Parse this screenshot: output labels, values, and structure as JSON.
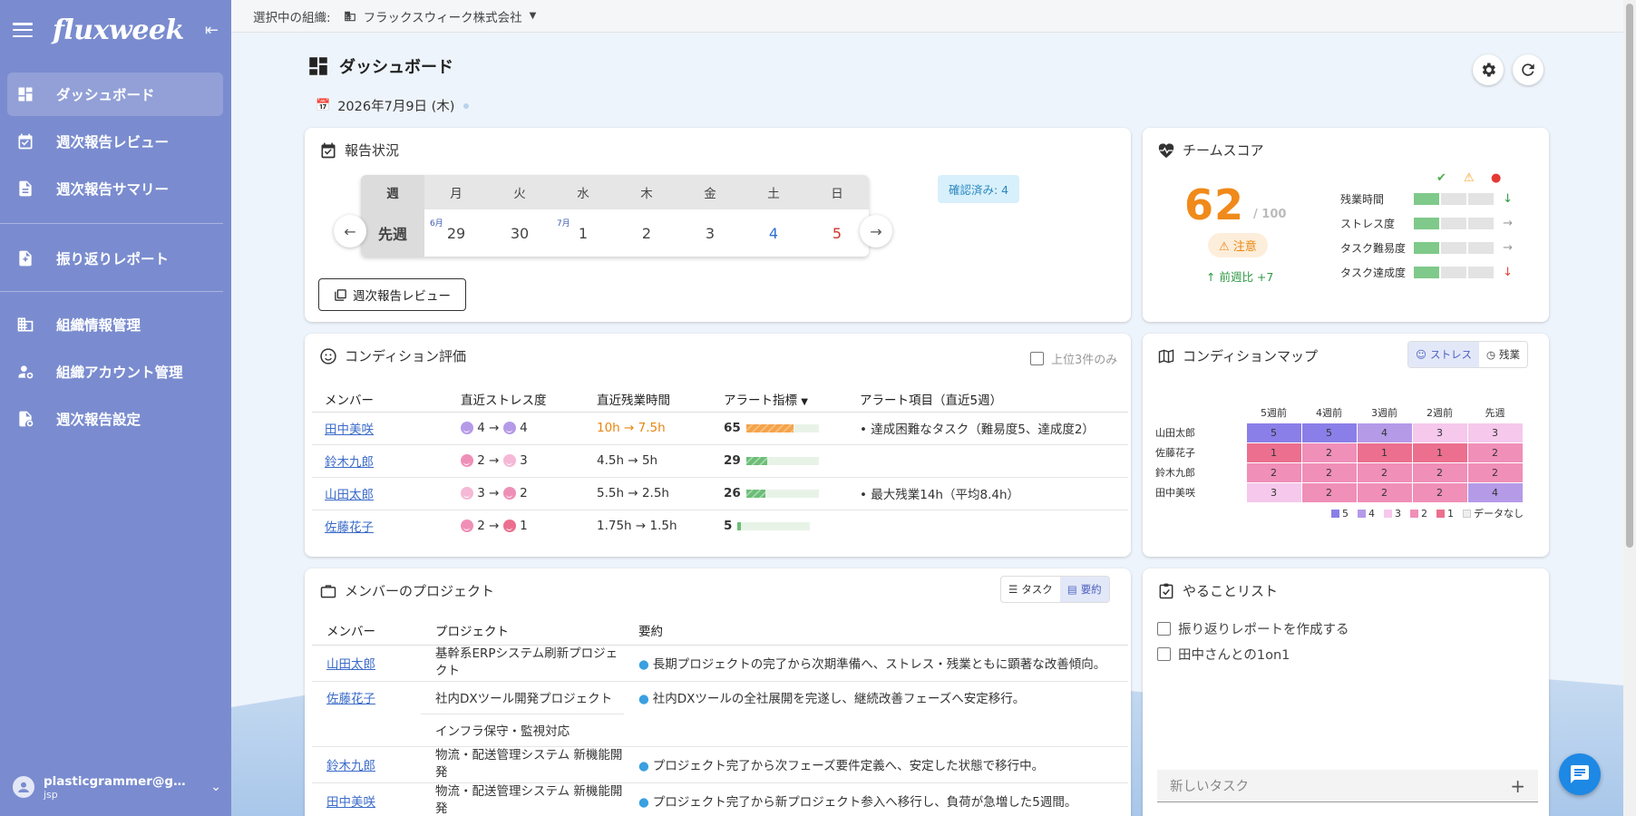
{
  "app": {
    "logo": "fluxweek"
  },
  "sidebar": {
    "items": [
      {
        "label": "ダッシュボード",
        "icon": "dashboard-icon"
      },
      {
        "label": "週次報告レビュー",
        "icon": "calendar-check-icon"
      },
      {
        "label": "週次報告サマリー",
        "icon": "document-icon"
      },
      {
        "label": "振り返りレポート",
        "icon": "document-add-icon"
      },
      {
        "label": "組織情報管理",
        "icon": "building-icon"
      },
      {
        "label": "組織アカウント管理",
        "icon": "user-gear-icon"
      },
      {
        "label": "週次報告設定",
        "icon": "document-gear-icon"
      }
    ],
    "user": {
      "email": "plasticgrammer@gmail.com",
      "sub": "jsp"
    }
  },
  "topbar": {
    "org_label": "選択中の組織:",
    "org_name": "フラックスウィーク株式会社"
  },
  "page": {
    "title": "ダッシュボード",
    "date": "2026年7月9日 (木)"
  },
  "report": {
    "title": "報告状況",
    "header": [
      "週",
      "月",
      "火",
      "水",
      "木",
      "金",
      "土",
      "日"
    ],
    "week_label": "先週",
    "days": [
      {
        "day": "29",
        "month": "6月"
      },
      {
        "day": "30",
        "month": ""
      },
      {
        "day": "1",
        "month": "7月"
      },
      {
        "day": "2",
        "month": ""
      },
      {
        "day": "3",
        "month": ""
      },
      {
        "day": "4",
        "month": ""
      },
      {
        "day": "5",
        "month": ""
      }
    ],
    "confirmed": "確認済み: 4",
    "review_button": "週次報告レビュー"
  },
  "team_score": {
    "title": "チームスコア",
    "score": "62",
    "max": "/ 100",
    "status": "注意",
    "trend": "前週比 +7",
    "metrics": [
      {
        "label": "残業時間",
        "level": 1,
        "trend": "↓",
        "trend_color": "#2e9a44"
      },
      {
        "label": "ストレス度",
        "level": 1,
        "trend": "→",
        "trend_color": "#999999"
      },
      {
        "label": "タスク難易度",
        "level": 1,
        "trend": "→",
        "trend_color": "#999999"
      },
      {
        "label": "タスク達成度",
        "level": 1,
        "trend": "↓",
        "trend_color": "#e0443a"
      }
    ],
    "colors": {
      "score": "#f08a1a",
      "ok": "#4caf50",
      "warn": "#f5a623",
      "danger": "#e53935"
    }
  },
  "condition": {
    "title": "コンディション評価",
    "top3_label": "上位3件のみ",
    "columns": [
      "メンバー",
      "直近ストレス度",
      "直近残業時間",
      "アラート指標",
      "アラート項目（直近5週）"
    ],
    "sort_marker": "▼",
    "rows": [
      {
        "member": "田中美咲",
        "stress_from": "4",
        "stress_to": "4",
        "ot_from": "10h",
        "ot_to": "7.5h",
        "alert": "65",
        "alert_pct": 65,
        "items": "• 達成困難なタスク（難易度5、達成度2）",
        "face_from": "#b59ae8",
        "face_to": "#b59ae8",
        "bar_color": "#f5a34a",
        "ot_color": "#e8850f"
      },
      {
        "member": "鈴木九郎",
        "stress_from": "2",
        "stress_to": "3",
        "ot_from": "4.5h",
        "ot_to": "5h",
        "alert": "29",
        "alert_pct": 29,
        "items": "",
        "face_from": "#ef8fb8",
        "face_to": "#f5b8d6",
        "bar_color": "#7fc98a",
        "ot_color": "#333333"
      },
      {
        "member": "山田太郎",
        "stress_from": "3",
        "stress_to": "2",
        "ot_from": "5.5h",
        "ot_to": "2.5h",
        "alert": "26",
        "alert_pct": 26,
        "items": "• 最大残業14h（平均8.4h）",
        "face_from": "#f5b8d6",
        "face_to": "#ef8fb8",
        "bar_color": "#7fc98a",
        "ot_color": "#333333"
      },
      {
        "member": "佐藤花子",
        "stress_from": "2",
        "stress_to": "1",
        "ot_from": "1.75h",
        "ot_to": "1.5h",
        "alert": "5",
        "alert_pct": 5,
        "items": "",
        "face_from": "#ef8fb8",
        "face_to": "#ec6f8f",
        "bar_color": "#7fc98a",
        "ot_color": "#333333"
      }
    ]
  },
  "map": {
    "title": "コンディションマップ",
    "toggle": [
      "ストレス",
      "残業"
    ],
    "weeks": [
      "5週前",
      "4週前",
      "3週前",
      "2週前",
      "先週"
    ],
    "rows": [
      {
        "name": "山田太郎",
        "values": [
          "5",
          "5",
          "4",
          "3",
          "3"
        ]
      },
      {
        "name": "佐藤花子",
        "values": [
          "1",
          "2",
          "1",
          "1",
          "2"
        ]
      },
      {
        "name": "鈴木九郎",
        "values": [
          "2",
          "2",
          "2",
          "2",
          "2"
        ]
      },
      {
        "name": "田中美咲",
        "values": [
          "3",
          "2",
          "2",
          "2",
          "4"
        ]
      }
    ],
    "colors": {
      "5": "#8a7fe8",
      "4": "#b59ae8",
      "3": "#f5c8ec",
      "2": "#f08fb8",
      "1": "#ec6f8f",
      "none": "#eeeeee"
    },
    "legend": [
      "5",
      "4",
      "3",
      "2",
      "1",
      "データなし"
    ]
  },
  "projects": {
    "title": "メンバーのプロジェクト",
    "toggle": [
      "タスク",
      "要約"
    ],
    "columns": [
      "メンバー",
      "プロジェクト",
      "要約"
    ],
    "rows": [
      {
        "member": "山田太郎",
        "project": "基幹系ERPシステム刷新プロジェクト",
        "summary": "長期プロジェクトの完了から次期準備へ、ストレス・残業ともに顕著な改善傾向。"
      },
      {
        "member": "佐藤花子",
        "project": "社内DXツール開発プロジェクト",
        "summary": "社内DXツールの全社展開を完遂し、継続改善フェーズへ安定移行。"
      },
      {
        "member": "",
        "project": "インフラ保守・監視対応",
        "summary": ""
      },
      {
        "member": "鈴木九郎",
        "project": "物流・配送管理システム 新機能開発",
        "summary": "プロジェクト完了から次フェーズ要件定義へ、安定した状態で移行中。"
      },
      {
        "member": "田中美咲",
        "project": "物流・配送管理システム 新機能開発",
        "summary": "プロジェクト完了から新プロジェクト参入へ移行し、負荷が急増した5週間。"
      }
    ]
  },
  "todo": {
    "title": "やることリスト",
    "items": [
      "振り返りレポートを作成する",
      "田中さんとの1on1"
    ],
    "new_placeholder": "新しいタスク",
    "add": "+"
  }
}
